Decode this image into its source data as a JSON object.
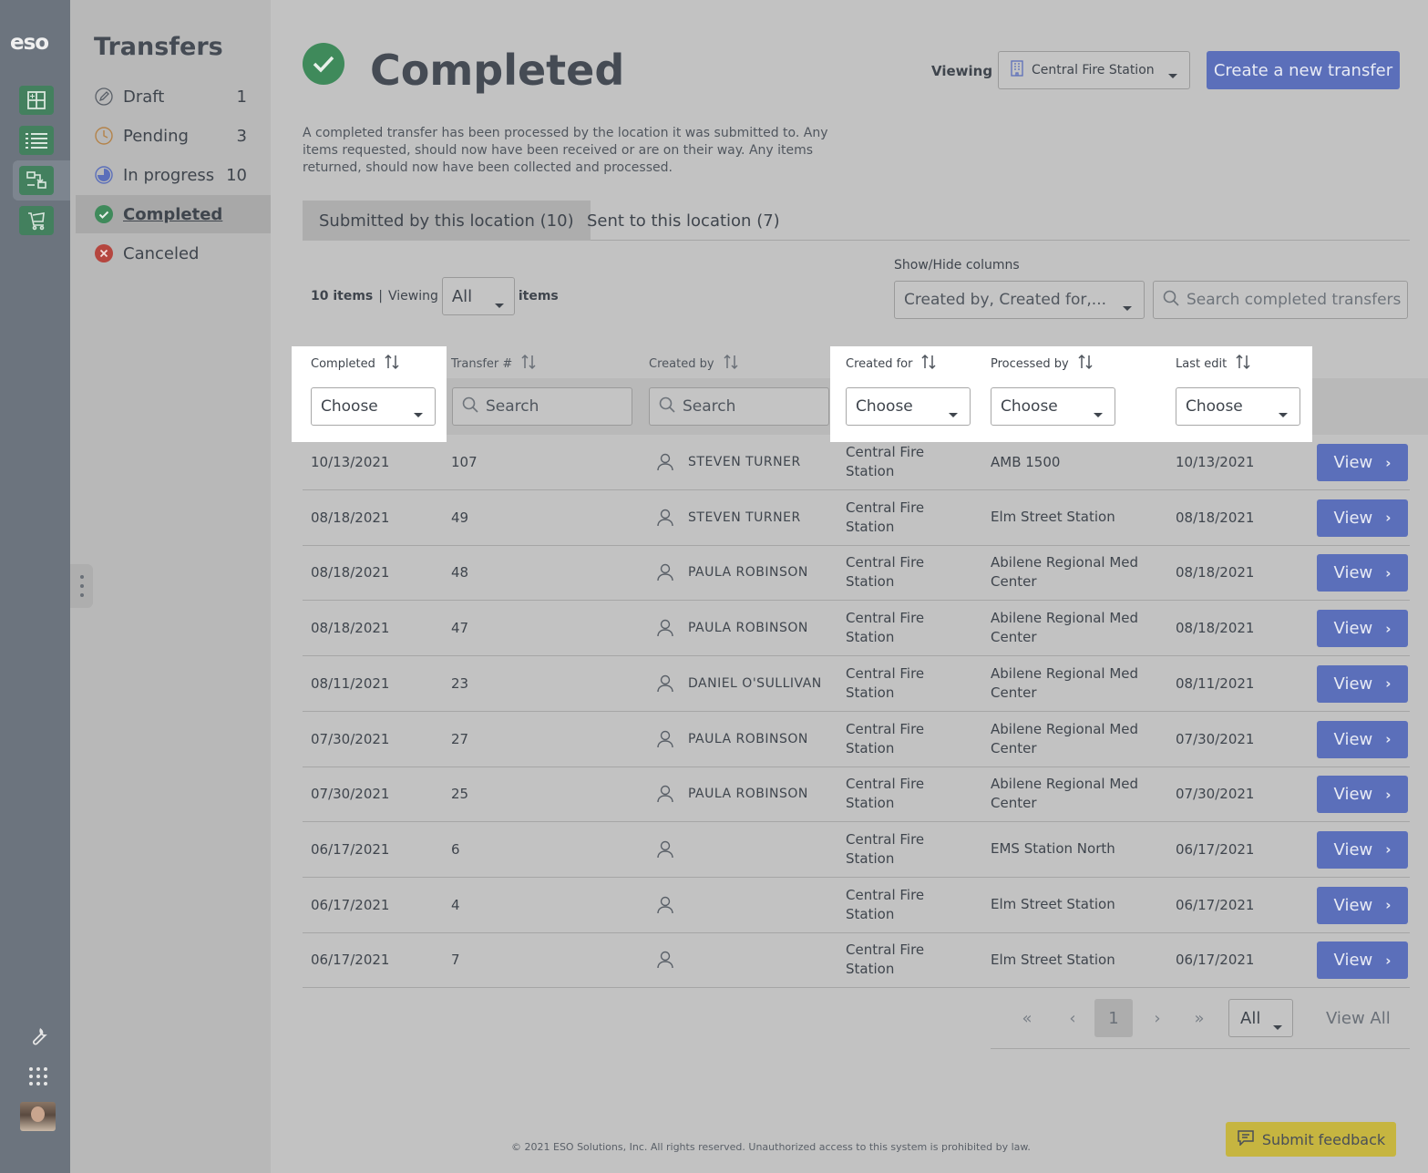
{
  "rail": {
    "logo": "eso",
    "nav": [
      {
        "icon": "building-grid-icon"
      },
      {
        "icon": "list-icon"
      },
      {
        "icon": "transfer-flow-icon"
      },
      {
        "icon": "cart-icon"
      }
    ],
    "tools": [
      {
        "icon": "wrench-icon"
      },
      {
        "icon": "app-grid-icon"
      }
    ],
    "avatar": "user-avatar"
  },
  "sidebar": {
    "title": "Transfers",
    "items": [
      {
        "label": "Draft",
        "count": "1",
        "icon": "pencil-circle-icon"
      },
      {
        "label": "Pending",
        "count": "3",
        "icon": "clock-icon"
      },
      {
        "label": "In progress",
        "count": "10",
        "icon": "progress-pie-icon"
      },
      {
        "label": "Completed",
        "count": "",
        "icon": "check-circle-icon"
      },
      {
        "label": "Canceled",
        "count": "",
        "icon": "x-circle-icon"
      }
    ]
  },
  "header": {
    "title": "Completed",
    "viewing_label": "Viewing",
    "station": "Central Fire Station",
    "create_button": "Create a new transfer",
    "description": "A completed transfer has been processed by the location it was submitted to. Any items requested, should now have been received or are on their way. Any items returned, should now have been collected and processed."
  },
  "tabs": [
    {
      "label": "Submitted by this location (10)",
      "active": true
    },
    {
      "label": "Sent to this location (7)",
      "active": false
    }
  ],
  "summary": {
    "count": "10 items",
    "separator": "|",
    "viewing": "Viewing",
    "viewing_value": "All",
    "suffix": "items"
  },
  "columns_control": {
    "label": "Show/Hide columns",
    "value": "Created by, Created for,...",
    "search_placeholder": "Search completed transfers"
  },
  "table": {
    "headers": {
      "completed": "Completed",
      "transfer": "Transfer #",
      "created_by": "Created by",
      "created_for": "Created for",
      "processed_by": "Processed by",
      "last_edit": "Last edit"
    },
    "filters": {
      "completed": "Choose",
      "transfer": "Search",
      "created_by": "Search",
      "created_for": "Choose",
      "processed_by": "Choose",
      "last_edit": "Choose"
    },
    "view_label": "View",
    "rows": [
      {
        "completed": "10/13/2021",
        "transfer": "107",
        "created_by": "STEVEN TURNER",
        "created_for": "Central Fire Station",
        "processed_by": "AMB 1500",
        "last_edit": "10/13/2021"
      },
      {
        "completed": "08/18/2021",
        "transfer": "49",
        "created_by": "STEVEN TURNER",
        "created_for": "Central Fire Station",
        "processed_by": "Elm Street Station",
        "last_edit": "08/18/2021"
      },
      {
        "completed": "08/18/2021",
        "transfer": "48",
        "created_by": "PAULA ROBINSON",
        "created_for": "Central Fire Station",
        "processed_by": "Abilene Regional Med Center",
        "last_edit": "08/18/2021"
      },
      {
        "completed": "08/18/2021",
        "transfer": "47",
        "created_by": "PAULA ROBINSON",
        "created_for": "Central Fire Station",
        "processed_by": "Abilene Regional Med Center",
        "last_edit": "08/18/2021"
      },
      {
        "completed": "08/11/2021",
        "transfer": "23",
        "created_by": "DANIEL O'SULLIVAN",
        "created_for": "Central Fire Station",
        "processed_by": "Abilene Regional Med Center",
        "last_edit": "08/11/2021"
      },
      {
        "completed": "07/30/2021",
        "transfer": "27",
        "created_by": "PAULA ROBINSON",
        "created_for": "Central Fire Station",
        "processed_by": "Abilene Regional Med Center",
        "last_edit": "07/30/2021"
      },
      {
        "completed": "07/30/2021",
        "transfer": "25",
        "created_by": "PAULA ROBINSON",
        "created_for": "Central Fire Station",
        "processed_by": "Abilene Regional Med Center",
        "last_edit": "07/30/2021"
      },
      {
        "completed": "06/17/2021",
        "transfer": "6",
        "created_by": "",
        "created_for": "Central Fire Station",
        "processed_by": "EMS Station North",
        "last_edit": "06/17/2021"
      },
      {
        "completed": "06/17/2021",
        "transfer": "4",
        "created_by": "",
        "created_for": "Central Fire Station",
        "processed_by": "Elm Street Station",
        "last_edit": "06/17/2021"
      },
      {
        "completed": "06/17/2021",
        "transfer": "7",
        "created_by": "",
        "created_for": "Central Fire Station",
        "processed_by": "Elm Street Station",
        "last_edit": "06/17/2021"
      }
    ]
  },
  "pagination": {
    "first": "«",
    "prev": "‹",
    "current_page": "1",
    "next": "›",
    "last": "»",
    "page_size": "All",
    "view_all": "View All"
  },
  "footer": {
    "copyright": "© 2021 ESO Solutions, Inc. All rights reserved. Unauthorized access to this system is prohibited by law.",
    "feedback": "Submit feedback"
  },
  "colors": {
    "primary": "#5b6fba",
    "success": "#3f8a5b",
    "danger": "#b5463f",
    "feedback": "#c6b540",
    "rail": "#6c747e"
  }
}
